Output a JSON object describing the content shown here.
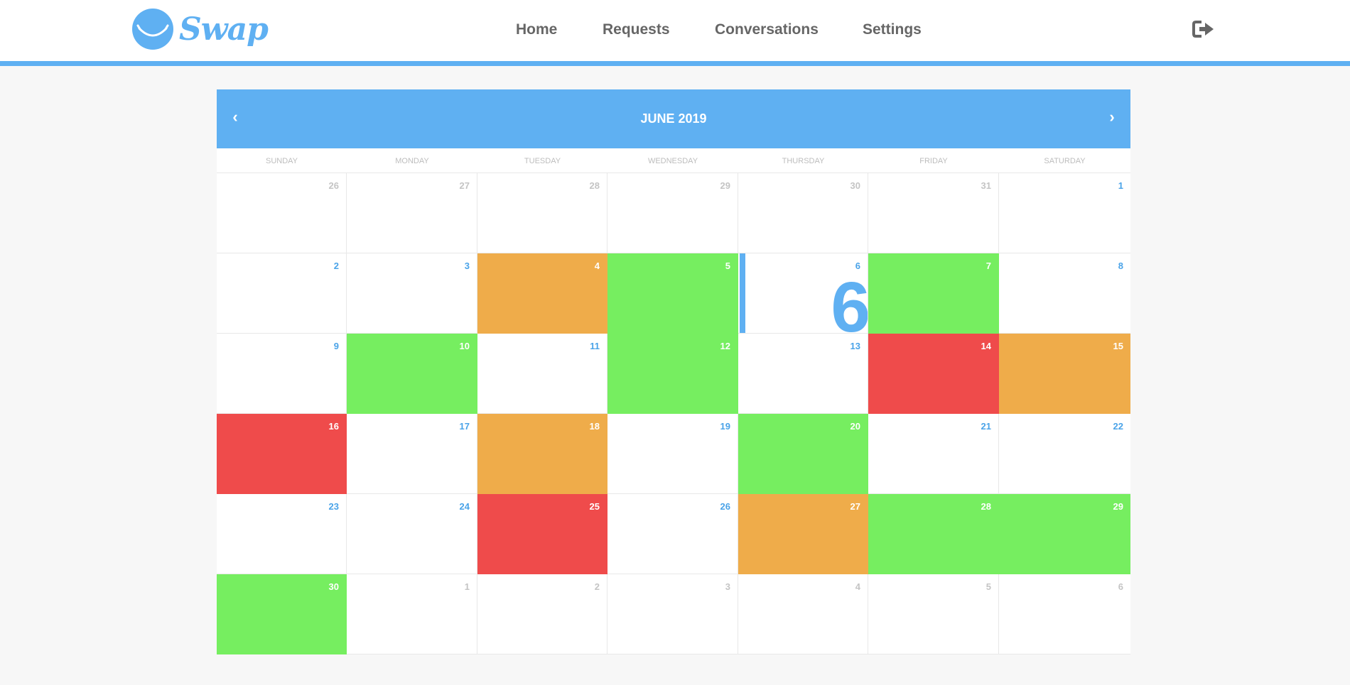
{
  "brand": {
    "name": "Swap",
    "color": "#5fb0f2"
  },
  "nav": {
    "items": [
      {
        "label": "Home"
      },
      {
        "label": "Requests"
      },
      {
        "label": "Conversations"
      },
      {
        "label": "Settings"
      }
    ],
    "logout_icon": "sign-out-icon"
  },
  "calendar": {
    "title": "JUNE 2019",
    "prev_icon": "chevron-left-icon",
    "next_icon": "chevron-right-icon",
    "weekdays": [
      "SUNDAY",
      "MONDAY",
      "TUESDAY",
      "WEDNESDAY",
      "THURSDAY",
      "FRIDAY",
      "SATURDAY"
    ],
    "today": "6",
    "status_colors": {
      "green": "#76ee60",
      "orange": "#efac4a",
      "red": "#ef4b4b"
    },
    "weeks": [
      [
        {
          "d": "26",
          "other": true
        },
        {
          "d": "27",
          "other": true
        },
        {
          "d": "28",
          "other": true
        },
        {
          "d": "29",
          "other": true
        },
        {
          "d": "30",
          "other": true
        },
        {
          "d": "31",
          "other": true
        },
        {
          "d": "1"
        }
      ],
      [
        {
          "d": "2"
        },
        {
          "d": "3"
        },
        {
          "d": "4",
          "status": "orange"
        },
        {
          "d": "5",
          "status": "green"
        },
        {
          "d": "6",
          "today": true
        },
        {
          "d": "7",
          "status": "green"
        },
        {
          "d": "8"
        }
      ],
      [
        {
          "d": "9"
        },
        {
          "d": "10",
          "status": "green"
        },
        {
          "d": "11"
        },
        {
          "d": "12",
          "status": "green"
        },
        {
          "d": "13"
        },
        {
          "d": "14",
          "status": "red"
        },
        {
          "d": "15",
          "status": "orange"
        }
      ],
      [
        {
          "d": "16",
          "status": "red"
        },
        {
          "d": "17"
        },
        {
          "d": "18",
          "status": "orange"
        },
        {
          "d": "19"
        },
        {
          "d": "20",
          "status": "green"
        },
        {
          "d": "21"
        },
        {
          "d": "22"
        }
      ],
      [
        {
          "d": "23"
        },
        {
          "d": "24"
        },
        {
          "d": "25",
          "status": "red"
        },
        {
          "d": "26"
        },
        {
          "d": "27",
          "status": "orange"
        },
        {
          "d": "28",
          "status": "green"
        },
        {
          "d": "29",
          "status": "green"
        }
      ],
      [
        {
          "d": "30",
          "status": "green"
        },
        {
          "d": "1",
          "other": true
        },
        {
          "d": "2",
          "other": true
        },
        {
          "d": "3",
          "other": true
        },
        {
          "d": "4",
          "other": true
        },
        {
          "d": "5",
          "other": true
        },
        {
          "d": "6",
          "other": true
        }
      ]
    ]
  }
}
